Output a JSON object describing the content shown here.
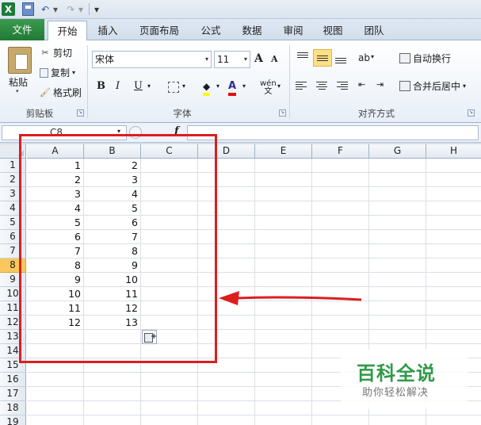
{
  "quick_access": {
    "app_icon": "X",
    "icons": [
      "excel-icon",
      "save-icon",
      "undo-icon",
      "redo-icon",
      "customize-icon"
    ]
  },
  "tabs": [
    "文件",
    "开始",
    "插入",
    "页面布局",
    "公式",
    "数据",
    "审阅",
    "视图",
    "团队"
  ],
  "ribbon": {
    "clipboard": {
      "paste": "粘贴",
      "cut": "剪切",
      "copy": "复制",
      "format_painter": "格式刷",
      "group_label": "剪贴板"
    },
    "font": {
      "name": "宋体",
      "size": "11",
      "bold": "B",
      "italic": "I",
      "underline": "U",
      "grow": "A",
      "shrink": "A",
      "font_color": "A",
      "fill": "◆",
      "phonetic": "wén\n文",
      "group_label": "字体"
    },
    "alignment": {
      "wrap_text": "自动换行",
      "merge_center": "合并后居中",
      "group_label": "对齐方式"
    }
  },
  "formula_bar": {
    "name_box": "C8",
    "fx": "fx",
    "value": ""
  },
  "sheet": {
    "columns": [
      "A",
      "B",
      "C",
      "D",
      "E",
      "F",
      "G",
      "H"
    ],
    "rows": [
      "1",
      "2",
      "3",
      "4",
      "5",
      "6",
      "7",
      "8",
      "9",
      "10",
      "11",
      "12",
      "13",
      "14",
      "15",
      "16",
      "17",
      "18",
      "19"
    ],
    "active_row": "8",
    "col_a": [
      "1",
      "2",
      "3",
      "4",
      "5",
      "6",
      "7",
      "8",
      "9",
      "10",
      "11",
      "12"
    ],
    "col_b": [
      "2",
      "3",
      "4",
      "5",
      "6",
      "7",
      "8",
      "9",
      "10",
      "11",
      "12",
      "13"
    ]
  },
  "annotation": {
    "color": "#dc1e1e"
  },
  "watermark": {
    "title": "百科全说",
    "subtitle": "助你轻松解决"
  },
  "colors": {
    "accent": "#217a35",
    "active_row": "#f9c85c",
    "highlight": "#fddf86"
  }
}
